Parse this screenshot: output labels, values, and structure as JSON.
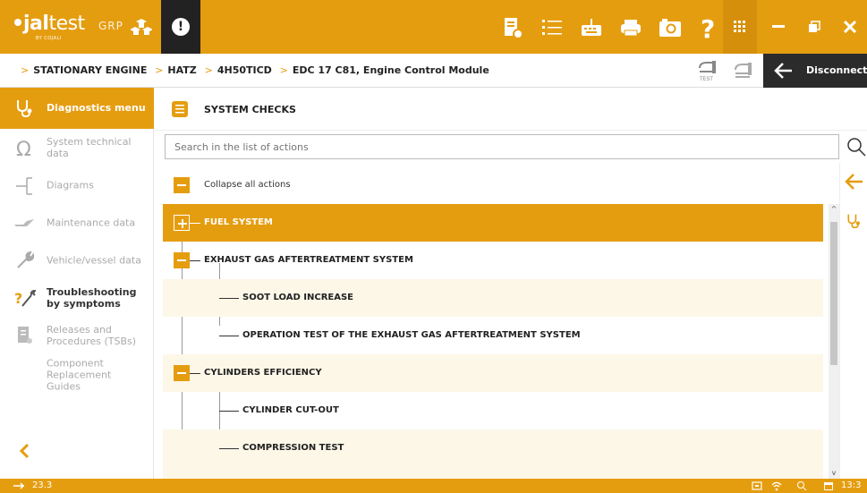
{
  "app": {
    "logo_prefix": "jal",
    "logo_suffix": "test",
    "logo_sub": "BY COJALI",
    "grp": "GRP"
  },
  "breadcrumb": [
    "STATIONARY ENGINE",
    "HATZ",
    "4H50TICD",
    "EDC 17 C81, Engine Control Module"
  ],
  "toolbar": {
    "test_label": "TEST",
    "disconnect_label": "Disconnect"
  },
  "sidebar": {
    "active_label": "Diagnostics menu",
    "items": [
      {
        "label": "System technical data",
        "icon": "omega-icon"
      },
      {
        "label": "Diagrams",
        "icon": "diagram-icon"
      },
      {
        "label": "Maintenance data",
        "icon": "oil-can-icon"
      },
      {
        "label": "Vehicle/vessel data",
        "icon": "wrench-icon"
      },
      {
        "label": "Troubleshooting by symptoms",
        "icon": "troubleshoot-icon"
      },
      {
        "label": "Releases and Procedures (TSBs)",
        "icon": "document-icon"
      },
      {
        "label": "Component Replacement Guides",
        "icon": ""
      }
    ]
  },
  "main": {
    "section_title": "SYSTEM CHECKS",
    "search_placeholder": "Search in the list of actions",
    "collapse_all_label": "Collapse all actions",
    "tree": [
      {
        "label": "FUEL SYSTEM",
        "level": 0,
        "expanded": false,
        "highlighted": true
      },
      {
        "label": "EXHAUST GAS AFTERTREATMENT SYSTEM",
        "level": 0,
        "expanded": true
      },
      {
        "label": "SOOT LOAD INCREASE",
        "level": 1
      },
      {
        "label": "OPERATION TEST OF THE EXHAUST GAS AFTERTREATMENT SYSTEM",
        "level": 1
      },
      {
        "label": "CYLINDERS EFFICIENCY",
        "level": 0,
        "expanded": true
      },
      {
        "label": "CYLINDER CUT-OUT",
        "level": 1
      },
      {
        "label": "COMPRESSION TEST",
        "level": 1
      }
    ]
  },
  "status": {
    "voltage": "23.3",
    "time": "13:3"
  },
  "colors": {
    "accent": "#e59d10",
    "dark": "#2b2b2b",
    "row_alt": "#fdf7e8"
  }
}
